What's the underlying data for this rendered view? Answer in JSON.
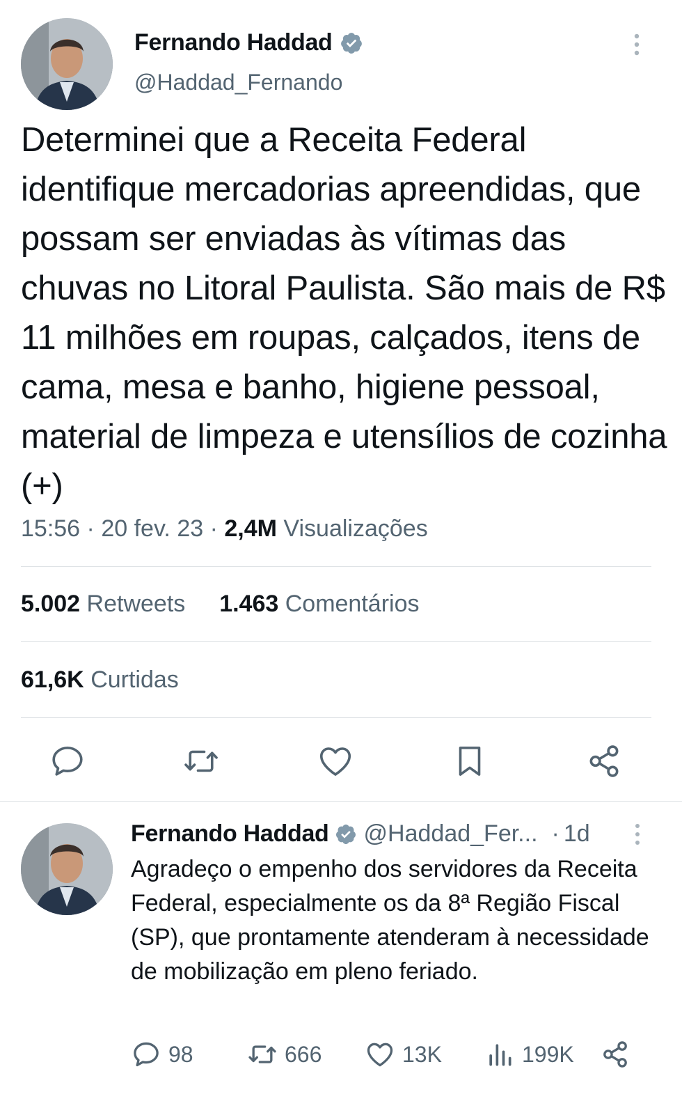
{
  "tweet": {
    "author_name": "Fernando Haddad",
    "author_handle": "@Haddad_Fernando",
    "text": "Determinei que a Receita Federal identifique mercadorias apreendidas, que possam ser enviadas às vítimas das chuvas no Litoral Paulista. São mais de R$ 11 milhões em roupas, calçados, itens de cama, mesa e banho, higiene pessoal, material de limpeza e utensílios de cozinha (+)",
    "time": "15:56",
    "date": "20 fev. 23",
    "views_count": "2,4M",
    "views_label": "Visualizações",
    "retweets_count": "5.002",
    "retweets_label": "Retweets",
    "comments_count": "1.463",
    "comments_label": "Comentários",
    "likes_count": "61,6K",
    "likes_label": "Curtidas"
  },
  "actions": [
    "reply-icon",
    "retweet-icon",
    "like-icon",
    "bookmark-icon",
    "share-icon"
  ],
  "reply": {
    "author_name": "Fernando Haddad",
    "author_handle": "@Haddad_Fer...",
    "separator": "·",
    "time_ago": "1d",
    "text": "Agradeço o empenho dos servidores da Receita Federal, especialmente os da 8ª Região Fiscal (SP), que prontamente atenderam à necessidade de mobilização em pleno feriado.",
    "replies": "98",
    "retweets": "666",
    "likes": "13K",
    "views": "199K"
  },
  "colors": {
    "text_primary": "#0f1419",
    "text_secondary": "#536471",
    "verified_badge": "#829aab",
    "divider": "#dfe3e6"
  }
}
